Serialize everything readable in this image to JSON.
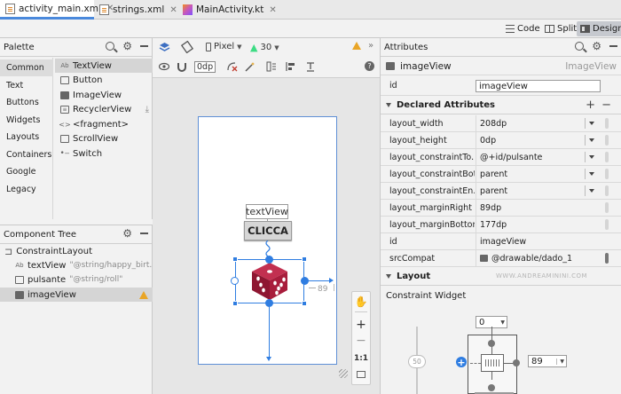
{
  "file_tabs": [
    {
      "label": "activity_main.xml",
      "icon": "xml-file-icon",
      "active": true
    },
    {
      "label": "strings.xml",
      "icon": "xml-file-icon",
      "active": false
    },
    {
      "label": "MainActivity.kt",
      "icon": "kotlin-file-icon",
      "active": false
    }
  ],
  "view_modes": {
    "code": "Code",
    "split": "Split",
    "design": "Design",
    "selected": "Design"
  },
  "palette": {
    "title": "Palette",
    "categories": [
      "Common",
      "Text",
      "Buttons",
      "Widgets",
      "Layouts",
      "Containers",
      "Google",
      "Legacy"
    ],
    "selected_category": "Common",
    "items": [
      {
        "label": "TextView",
        "icon": "text-ab-icon"
      },
      {
        "label": "Button",
        "icon": "button-icon"
      },
      {
        "label": "ImageView",
        "icon": "image-icon"
      },
      {
        "label": "RecyclerView",
        "icon": "list-icon"
      },
      {
        "label": "<fragment>",
        "icon": "code-brackets-icon"
      },
      {
        "label": "ScrollView",
        "icon": "scroll-icon"
      },
      {
        "label": "Switch",
        "icon": "switch-icon"
      }
    ]
  },
  "component_tree": {
    "title": "Component Tree",
    "root": "ConstraintLayout",
    "children": [
      {
        "label": "textView",
        "hint": "\"@string/happy_birt...",
        "icon": "text-ab-icon"
      },
      {
        "label": "pulsante",
        "hint": "\"@string/roll\"",
        "icon": "button-icon"
      },
      {
        "label": "imageView",
        "hint": "",
        "icon": "image-icon",
        "selected": true,
        "warning": true
      }
    ]
  },
  "design_toolbar": {
    "device": "Pixel",
    "api": "30",
    "margin": "0dp"
  },
  "canvas": {
    "textview_text": "textView",
    "button_text": "CLICCA",
    "margin_label": "89",
    "zoom_fit": "1:1"
  },
  "attributes": {
    "title": "Attributes",
    "component": "imageView",
    "component_type": "ImageView",
    "id_label": "id",
    "id_value": "imageView",
    "declared_title": "Declared Attributes",
    "declared": [
      {
        "key": "layout_width",
        "value": "208dp"
      },
      {
        "key": "layout_height",
        "value": "0dp"
      },
      {
        "key": "layout_constraintTo...",
        "value": "@+id/pulsante"
      },
      {
        "key": "layout_constraintBot...",
        "value": "parent"
      },
      {
        "key": "layout_constraintEn...",
        "value": "parent"
      },
      {
        "key": "layout_marginRight",
        "value": "89dp"
      },
      {
        "key": "layout_marginBottom",
        "value": "177dp"
      },
      {
        "key": "id",
        "value": "imageView"
      },
      {
        "key": "srcCompat",
        "value": "@drawable/dado_1"
      }
    ],
    "layout_title": "Layout",
    "constraint_widget_title": "Constraint Widget",
    "constraint_top": "0",
    "constraint_right": "89",
    "slider_value": "50",
    "watermark": "WWW.ANDREAMININI.COM"
  }
}
